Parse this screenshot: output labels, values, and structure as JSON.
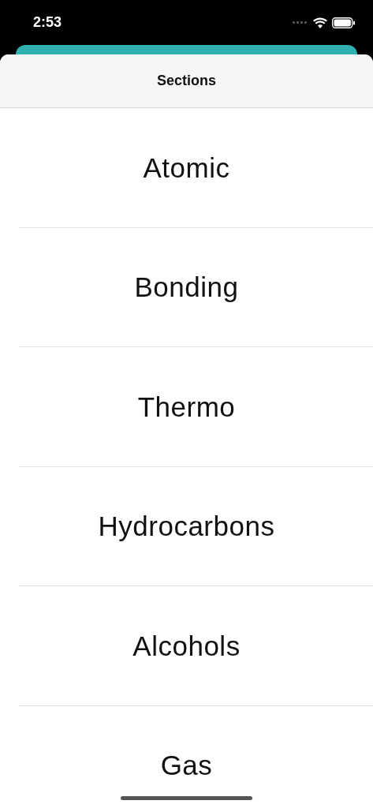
{
  "status_bar": {
    "time": "2:53"
  },
  "navigation": {
    "title": "Sections"
  },
  "sections": [
    {
      "label": "Atomic"
    },
    {
      "label": "Bonding"
    },
    {
      "label": "Thermo"
    },
    {
      "label": "Hydrocarbons"
    },
    {
      "label": "Alcohols"
    },
    {
      "label": "Gas"
    }
  ]
}
